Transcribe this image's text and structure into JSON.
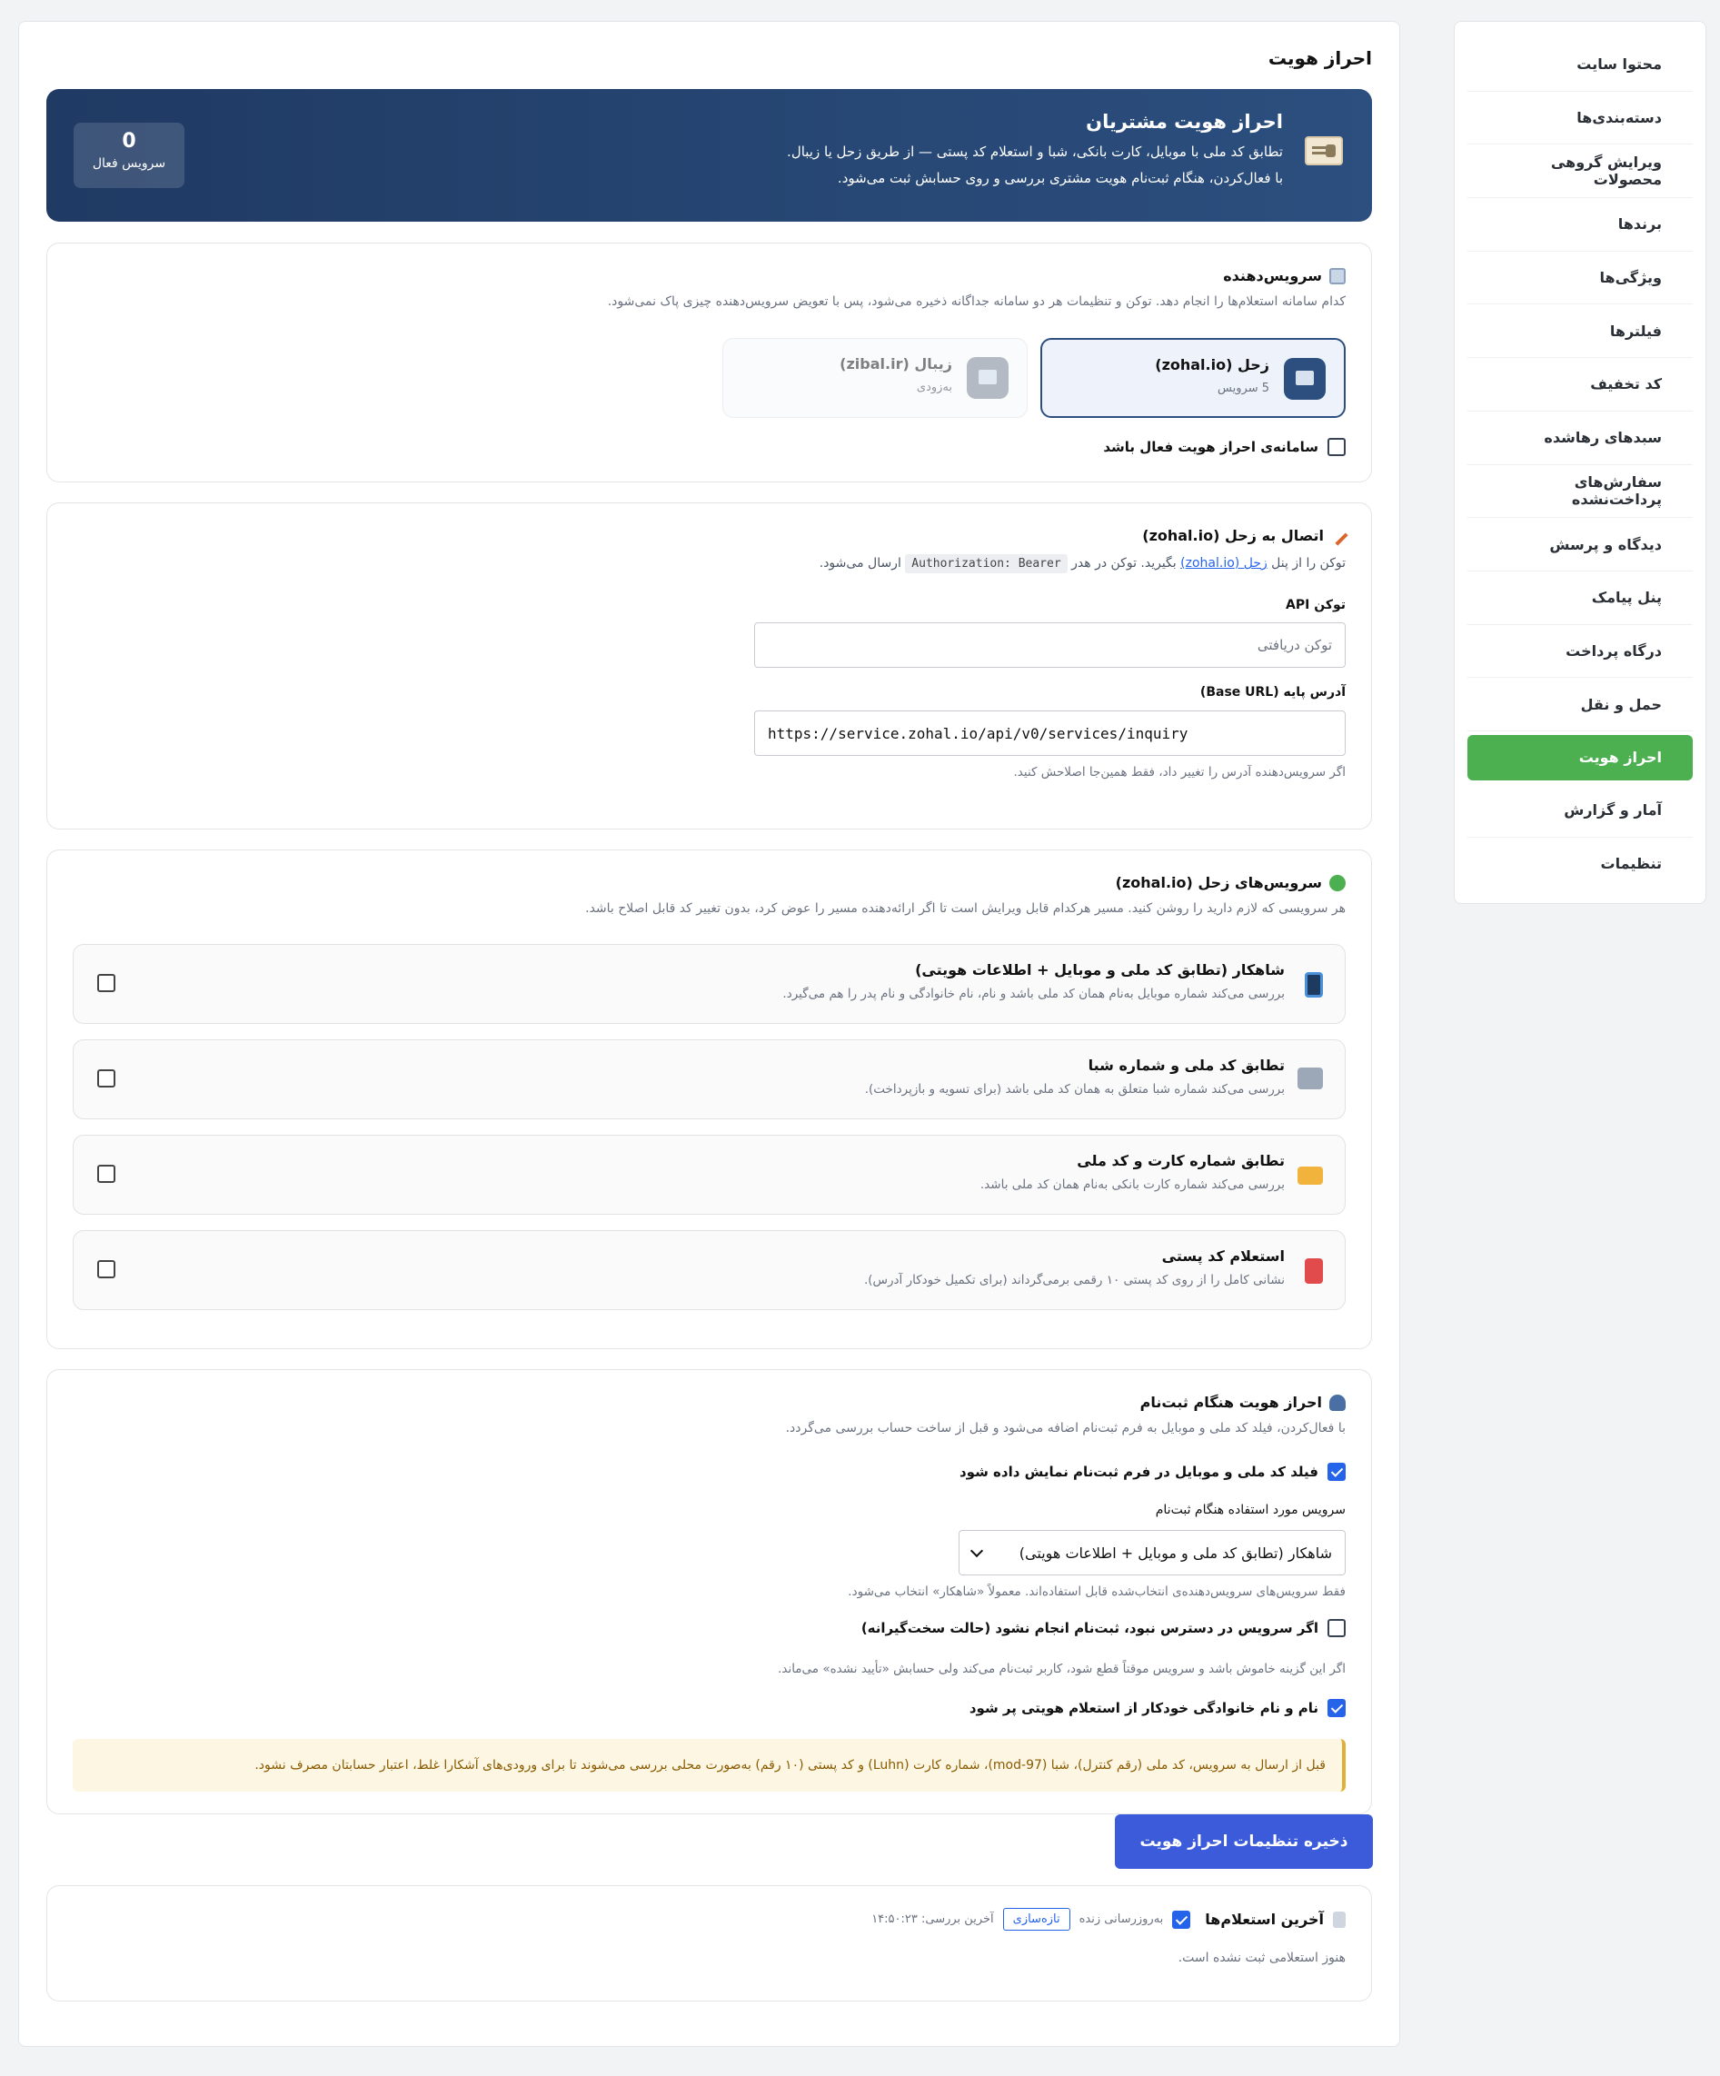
{
  "sidebar": {
    "items": [
      {
        "label": "محتوا سایت"
      },
      {
        "label": "دسته‌بندی‌ها"
      },
      {
        "label": "ویرایش گروهی محصولات"
      },
      {
        "label": "برندها"
      },
      {
        "label": "ویژگی‌ها"
      },
      {
        "label": "فیلترها"
      },
      {
        "label": "کد تخفیف"
      },
      {
        "label": "سبدهای رهاشده"
      },
      {
        "label": "سفارش‌های پرداخت‌نشده"
      },
      {
        "label": "دیدگاه و پرسش"
      },
      {
        "label": "پنل پیامک"
      },
      {
        "label": "درگاه پرداخت"
      },
      {
        "label": "حمل و نقل"
      },
      {
        "label": "احراز هویت"
      },
      {
        "label": "آمار و گزارش"
      },
      {
        "label": "تنظیمات"
      }
    ]
  },
  "page": {
    "title": "احراز هویت"
  },
  "hero": {
    "title": "احراز هویت مشتریان",
    "line1": "تطابق کد ملی با موبایل، کارت بانکی، شبا و استعلام کد پستی — از طریق زحل یا زیبال.",
    "line2": "با فعال‌کردن، هنگام ثبت‌نام هویت مشتری بررسی و روی حسابش ثبت می‌شود.",
    "badge_count": "0",
    "badge_label": "سرویس فعال"
  },
  "provider_card": {
    "title": "سرویس‌دهنده",
    "desc": "کدام سامانه استعلام‌ها را انجام دهد. توکن و تنظیمات هر دو سامانه جداگانه ذخیره می‌شود، پس با تعویض سرویس‌دهنده چیزی پاک نمی‌شود.",
    "providers": [
      {
        "name": "زحل (zohal.io)",
        "sub": "5 سرویس"
      },
      {
        "name": "زیبال (zibal.ir)",
        "sub": "به‌زودی"
      }
    ],
    "enable_label": "سامانه‌ی احراز هویت فعال باشد"
  },
  "connection_card": {
    "title": "اتصال به زحل (zohal.io)",
    "desc_pre": "توکن را از پنل ",
    "desc_link": "زحل (zohal.io)",
    "desc_mid": " بگیرید. توکن در هدر ",
    "desc_code": "Authorization: Bearer",
    "desc_post": " ارسال می‌شود.",
    "token_label": "توکن API",
    "token_placeholder": "توکن دریافتی",
    "baseurl_label": "آدرس پایه (Base URL)",
    "baseurl_value": "https://service.zohal.io/api/v0/services/inquiry",
    "baseurl_hint": "اگر سرویس‌دهنده آدرس را تغییر داد، فقط همین‌جا اصلاحش کنید."
  },
  "services_card": {
    "title": "سرویس‌های زحل (zohal.io)",
    "desc": "هر سرویسی که لازم دارید را روشن کنید. مسیر هرکدام قابل ویرایش است تا اگر ارائه‌دهنده مسیر را عوض کرد، بدون تغییر کد قابل اصلاح باشد.",
    "services": [
      {
        "title": "شاهکار (تطابق کد ملی و موبایل + اطلاعات هویتی)",
        "desc": "بررسی می‌کند شماره موبایل به‌نام همان کد ملی باشد و نام، نام خانوادگی و نام پدر را هم می‌گیرد."
      },
      {
        "title": "تطابق کد ملی و شماره شبا",
        "desc": "بررسی می‌کند شماره شبا متعلق به همان کد ملی باشد (برای تسویه و بازپرداخت)."
      },
      {
        "title": "تطابق شماره کارت و کد ملی",
        "desc": "بررسی می‌کند شماره کارت بانکی به‌نام همان کد ملی باشد."
      },
      {
        "title": "استعلام کد پستی",
        "desc": "نشانی کامل را از روی کد پستی ۱۰ رقمی برمی‌گرداند (برای تکمیل خودکار آدرس)."
      }
    ]
  },
  "signup_card": {
    "title": "احراز هویت هنگام ثبت‌نام",
    "desc": "با فعال‌کردن، فیلد کد ملی و موبایل به فرم ثبت‌نام اضافه می‌شود و قبل از ساخت حساب بررسی می‌گردد.",
    "show_field_label": "فیلد کد ملی و موبایل در فرم ثبت‌نام نمایش داده شود",
    "service_label": "سرویس مورد استفاده هنگام ثبت‌نام",
    "service_selected": "شاهکار (تطابق کد ملی و موبایل + اطلاعات هویتی)",
    "service_hint": "فقط سرویس‌های سرویس‌دهنده‌ی انتخاب‌شده قابل استفاده‌اند. معمولاً «شاهکار» انتخاب می‌شود.",
    "strict_label": "اگر سرویس در دسترس نبود، ثبت‌نام انجام نشود (حالت سخت‌گیرانه)",
    "strict_hint": "اگر این گزینه خاموش باشد و سرویس موقتاً قطع شود، کاربر ثبت‌نام می‌کند ولی حسابش «تأیید نشده» می‌ماند.",
    "autofill_label": "نام و نام خانوادگی خودکار از استعلام هویتی پر شود",
    "warning": "قبل از ارسال به سرویس، کد ملی (رقم کنترل)، شبا (mod-97)، شماره کارت (Luhn) و کد پستی (۱۰ رقم) به‌صورت محلی بررسی می‌شوند تا برای ورودی‌های آشکارا غلط، اعتبار حسابتان مصرف نشود."
  },
  "save_button": "ذخیره تنظیمات احراز هویت",
  "recent_card": {
    "title": "آخرین استعلام‌ها",
    "auto_refresh_label": "به‌روزرسانی زنده",
    "refresh_button": "تازه‌سازی",
    "last_check": "آخرین بررسی: ۱۴:۵۰:۲۳",
    "empty": "هنوز استعلامی ثبت نشده است."
  }
}
